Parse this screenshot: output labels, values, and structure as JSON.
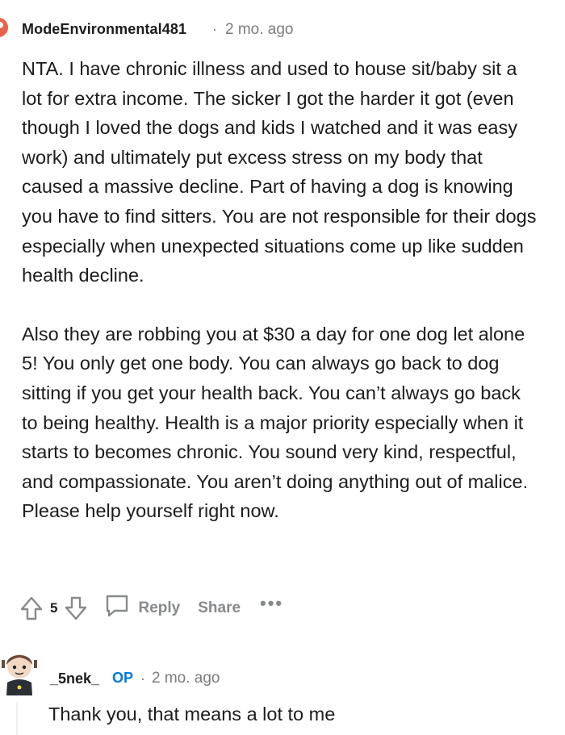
{
  "comment": {
    "username": "ModeEnvironmental481",
    "separator": "·",
    "time": "2 mo. ago",
    "paragraphs": [
      "NTA. I have chronic illness and used to house sit/baby sit a lot for extra income. The sicker I got the harder it got (even though I loved the dogs and kids I watched and it was easy work) and ultimately put excess stress on my body that caused a massive decline. Part of having a dog is knowing you have to find sitters. You are not responsible for their dogs especially when unexpected situations come up like sudden health decline.",
      "Also they are robbing you at $30 a day for one dog let alone 5! You only get one body. You can always go back to dog sitting if you get your health back. You can’t always go back to being healthy. Health is a major priority especially when it starts to becomes chronic. You sound very kind, respectful, and compassionate. You aren’t doing anything out of malice. Please help yourself right now."
    ],
    "votes": "5",
    "reply_label": "Reply",
    "share_label": "Share",
    "more_label": "•••"
  },
  "reply": {
    "username": "_5nek_",
    "op_badge": "OP",
    "separator": "·",
    "time": "2 mo. ago",
    "text": "Thank you, that means a lot to me"
  },
  "colors": {
    "text": "#1c1c1c",
    "meta": "#7c7c7c",
    "action": "#878a8c",
    "op": "#0079d3"
  }
}
